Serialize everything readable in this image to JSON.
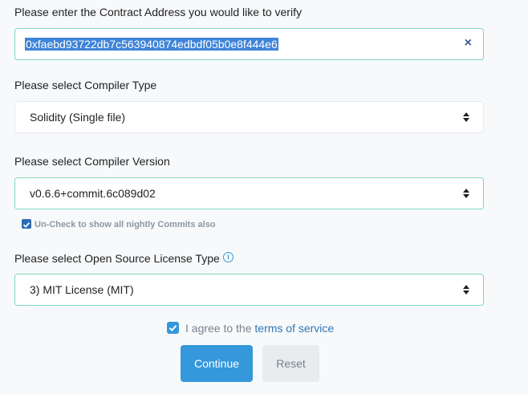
{
  "contract": {
    "label": "Please enter the Contract Address you would like to verify",
    "value": "0xfaebd93722db7c563940874edbdf05b0e8f444e6",
    "clear_icon": "×"
  },
  "compiler_type": {
    "label": "Please select Compiler Type",
    "selected": "Solidity (Single file)"
  },
  "compiler_version": {
    "label": "Please select Compiler Version",
    "selected": "v0.6.6+commit.6c089d02",
    "nightly_note": "Un-Check to show all nightly Commits also",
    "nightly_checked": true
  },
  "license": {
    "label": "Please select Open Source License Type",
    "selected": "3) MIT License (MIT)",
    "info_icon": "i"
  },
  "agree": {
    "prefix": "I agree to the ",
    "link": "terms of service",
    "checked": true
  },
  "buttons": {
    "continue": "Continue",
    "reset": "Reset"
  },
  "colors": {
    "accent": "#3498db",
    "focus_border": "#7fd6c3",
    "link": "#2d77b7"
  }
}
